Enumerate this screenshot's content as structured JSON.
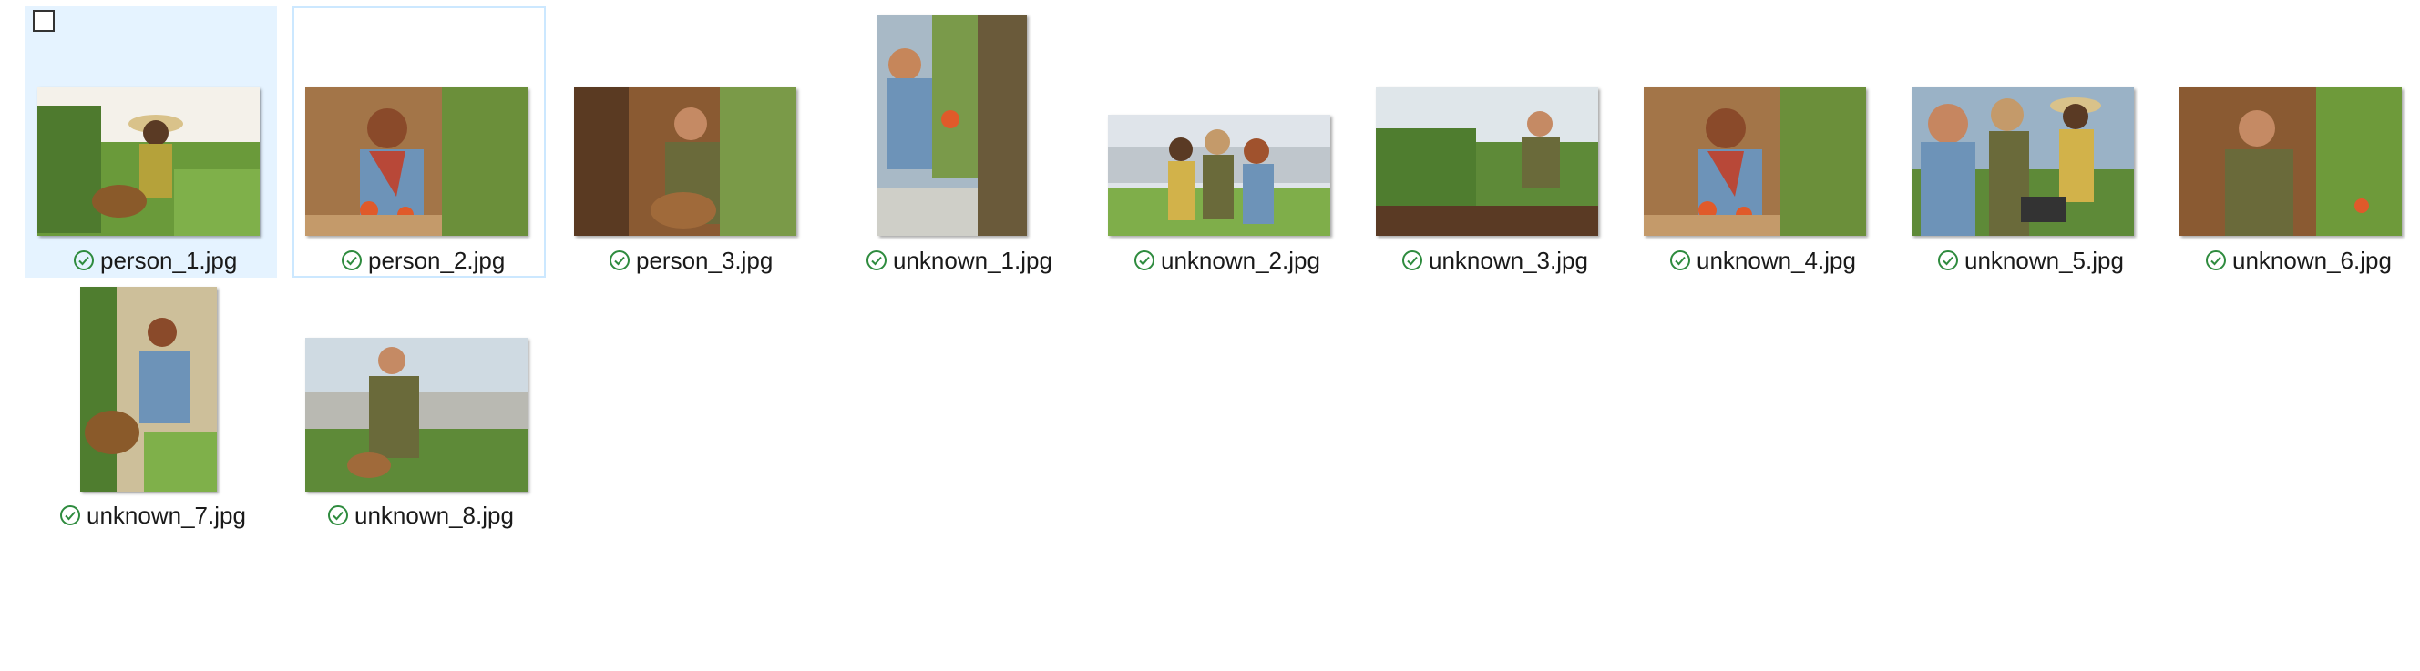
{
  "files": [
    {
      "name": "person_1.jpg",
      "status": "synced",
      "selected": true
    },
    {
      "name": "person_2.jpg",
      "status": "synced",
      "focused": true
    },
    {
      "name": "person_3.jpg",
      "status": "synced"
    },
    {
      "name": "unknown_1.jpg",
      "status": "synced"
    },
    {
      "name": "unknown_2.jpg",
      "status": "synced"
    },
    {
      "name": "unknown_3.jpg",
      "status": "synced"
    },
    {
      "name": "unknown_4.jpg",
      "status": "synced"
    },
    {
      "name": "unknown_5.jpg",
      "status": "synced"
    },
    {
      "name": "unknown_6.jpg",
      "status": "synced"
    },
    {
      "name": "unknown_7.jpg",
      "status": "synced"
    },
    {
      "name": "unknown_8.jpg",
      "status": "synced"
    }
  ],
  "colors": {
    "selection_bg": "#e5f3ff",
    "focus_border": "#cce8ff",
    "status_green": "#2e8b3e"
  },
  "icons": {
    "status": "check-circle-icon",
    "select": "checkbox-icon"
  }
}
